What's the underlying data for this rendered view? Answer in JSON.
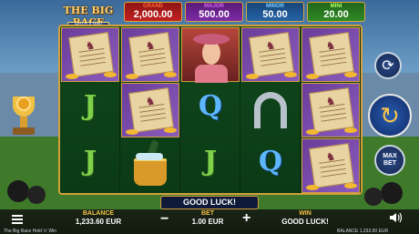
{
  "logo": {
    "title": "THE BIG RACE",
    "subtitle": "HOLD & WIN"
  },
  "jackpots": [
    {
      "name": "GRAND",
      "value": "2,000.00"
    },
    {
      "name": "MAJOR",
      "value": "500.00"
    },
    {
      "name": "MINOR",
      "value": "50.00"
    },
    {
      "name": "MINI",
      "value": "20.00"
    }
  ],
  "reels": [
    [
      "race-map",
      "j-card",
      "j-card"
    ],
    [
      "race-map",
      "race-map",
      "champagne-bucket"
    ],
    [
      "jockey-lady",
      "q-card",
      "j-card"
    ],
    [
      "race-map",
      "horseshoe",
      "q-card"
    ],
    [
      "race-map",
      "race-map",
      "race-map"
    ]
  ],
  "symbols": {
    "j": "J",
    "q": "Q"
  },
  "message": "GOOD LUCK!",
  "controls": {
    "balance_label": "BALANCE",
    "balance_value": "1,233.60 EUR",
    "bet_label": "BET",
    "bet_value": "1.00 EUR",
    "win_label": "WIN",
    "win_value": "GOOD LUCK!",
    "maxbet_label": "MAX BET"
  },
  "footer": {
    "game_name": "The Big Race Hold 'n' Win",
    "balance": "BALANCE 1,233.60 EUR"
  },
  "colors": {
    "frame": "#d2a03c",
    "accent": "#f2c24a"
  }
}
